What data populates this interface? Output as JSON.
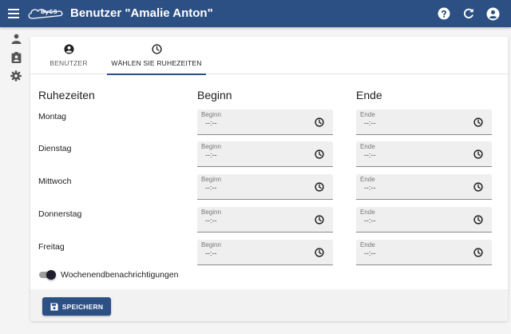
{
  "header": {
    "title": "Benutzer \"Amalie Anton\"",
    "logo_text": "ByCS",
    "icons": [
      "menu-icon",
      "help-icon",
      "refresh-icon",
      "account-icon"
    ]
  },
  "sidebar": {
    "items": [
      {
        "icon": "person-icon"
      },
      {
        "icon": "clipboard-account-icon"
      },
      {
        "icon": "gear-icon"
      }
    ]
  },
  "tabs": [
    {
      "label": "Benutzer",
      "icon": "account-circle-icon",
      "active": false
    },
    {
      "label": "Wählen Sie Ruhezeiten",
      "icon": "clock-icon",
      "active": true
    }
  ],
  "columns": {
    "rest": "Ruhezeiten",
    "start": "Beginn",
    "end": "Ende"
  },
  "rows": [
    {
      "day": "Montag",
      "start_label": "Beginn",
      "start_value": "--:--",
      "end_label": "Ende",
      "end_value": "--:--"
    },
    {
      "day": "Dienstag",
      "start_label": "Beginn",
      "start_value": "--:--",
      "end_label": "Ende",
      "end_value": "--:--"
    },
    {
      "day": "Mittwoch",
      "start_label": "Beginn",
      "start_value": "--:--",
      "end_label": "Ende",
      "end_value": "--:--"
    },
    {
      "day": "Donnerstag",
      "start_label": "Beginn",
      "start_value": "--:--",
      "end_label": "Ende",
      "end_value": "--:--"
    },
    {
      "day": "Freitag",
      "start_label": "Beginn",
      "start_value": "--:--",
      "end_label": "Ende",
      "end_value": "--:--"
    }
  ],
  "weekend_toggle": {
    "label": "Wochenendbenachrichtigungen",
    "checked": true
  },
  "footer": {
    "save_label": "Speichern",
    "save_icon": "floppy-disk-icon"
  },
  "colors": {
    "primary": "#2c4f84",
    "background": "#f4f4f5",
    "field": "#efefef"
  }
}
